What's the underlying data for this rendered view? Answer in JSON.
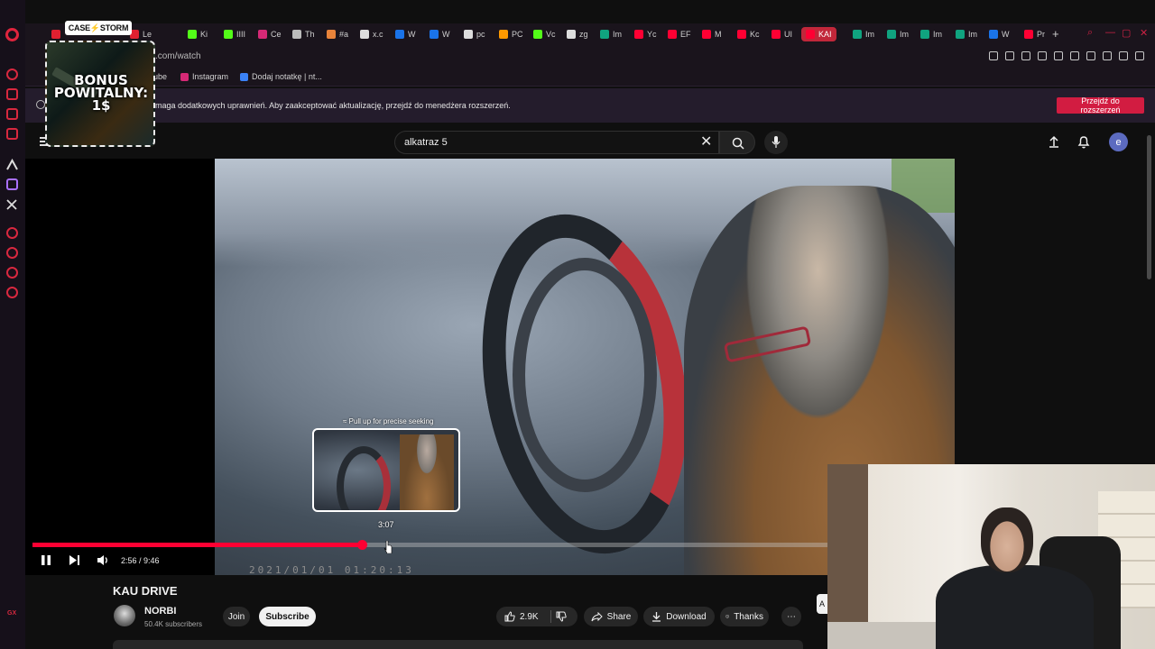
{
  "browser": {
    "tabs": [
      {
        "label": "",
        "color": "#e02030"
      },
      {
        "label": "Le",
        "color": "#e02030"
      },
      {
        "label": "Ki",
        "color": "#53fc18"
      },
      {
        "label": "IIII",
        "color": "#53fc18"
      },
      {
        "label": "Ce",
        "color": "#d62976"
      },
      {
        "label": "Th",
        "color": "#bbbbbb"
      },
      {
        "label": "#a",
        "color": "#e8833a"
      },
      {
        "label": "x.c",
        "color": "#dddddd"
      },
      {
        "label": "W",
        "color": "#1a73e8"
      },
      {
        "label": "W",
        "color": "#1a73e8"
      },
      {
        "label": "pc",
        "color": "#dddddd"
      },
      {
        "label": "PC",
        "color": "#ff9900"
      },
      {
        "label": "Vc",
        "color": "#53fc18"
      },
      {
        "label": "zg",
        "color": "#dddddd"
      },
      {
        "label": "Im",
        "color": "#10a37f"
      },
      {
        "label": "Yc",
        "color": "#ff0033"
      },
      {
        "label": "EF",
        "color": "#ff0033"
      },
      {
        "label": "M",
        "color": "#ff0033"
      },
      {
        "label": "Kc",
        "color": "#ff0033"
      },
      {
        "label": "UI",
        "color": "#ff0033"
      },
      {
        "label": "KAI",
        "color": "#ff0033",
        "active": true
      },
      {
        "label": "Im",
        "color": "#10a37f"
      },
      {
        "label": "Im",
        "color": "#10a37f"
      },
      {
        "label": "Im",
        "color": "#10a37f"
      },
      {
        "label": "Im",
        "color": "#10a37f"
      },
      {
        "label": "W",
        "color": "#1a73e8"
      },
      {
        "label": "Pr",
        "color": "#ff0033"
      }
    ],
    "url": ".com/watch",
    "bookmarks": [
      {
        "label": "ube",
        "color": "#ff0033"
      },
      {
        "label": "Instagram",
        "color": "#d62976"
      },
      {
        "label": "Dodaj notatkę | nt...",
        "color": "#3b82f6"
      }
    ],
    "notice": {
      "text": "maga dodatkowych uprawnień. Aby zaakceptować aktualizację, przejdź do menedżera rozszerzeń.",
      "button": "Przejdź do rozszerzeń"
    }
  },
  "promo": {
    "logo": "CASE⚡STORM",
    "text": "BONUS POWITALNY: 1$"
  },
  "youtube": {
    "search_value": "alkatraz 5",
    "avatar_letter": "e"
  },
  "player": {
    "seek_hint": "≈ Pull up for precise seeking",
    "preview_time": "3:07",
    "time_display": "2:56 / 9:46",
    "progress_fraction": 0.4142,
    "timestamp_overlay": "2021/01/01  01:20:13"
  },
  "video": {
    "title": "KAU DRIVE",
    "channel": "NORBI",
    "subscribers": "50.4K subscribers",
    "join": "Join",
    "subscribe": "Subscribe",
    "likes": "2.9K",
    "share": "Share",
    "download": "Download",
    "thanks": "Thanks",
    "more": "⋯",
    "side_tab": "A"
  },
  "sidebar": {
    "badge": "GX"
  },
  "colors": {
    "accent": "#ff0033",
    "opera": "#e0243d",
    "notice_button": "#d21c41"
  }
}
